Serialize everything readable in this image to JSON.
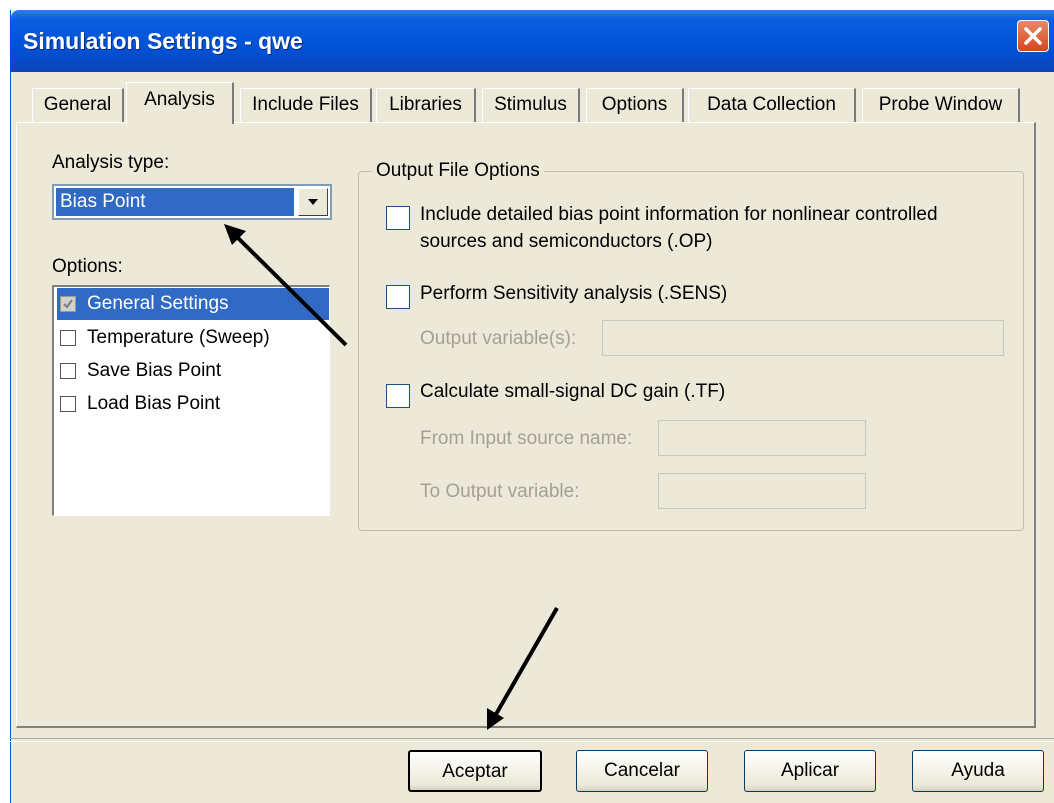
{
  "window": {
    "title": "Simulation Settings - qwe",
    "close_icon": "close-x-icon"
  },
  "tabs": [
    {
      "label": "General",
      "active": false
    },
    {
      "label": "Analysis",
      "active": true
    },
    {
      "label": "Include Files",
      "active": false
    },
    {
      "label": "Libraries",
      "active": false
    },
    {
      "label": "Stimulus",
      "active": false
    },
    {
      "label": "Options",
      "active": false
    },
    {
      "label": "Data Collection",
      "active": false
    },
    {
      "label": "Probe Window",
      "active": false
    }
  ],
  "analysis": {
    "type_label": "Analysis type:",
    "type_value": "Bias Point",
    "options_label": "Options:",
    "options": [
      {
        "label": "General Settings",
        "checked": true,
        "selected": true
      },
      {
        "label": "Temperature (Sweep)",
        "checked": false,
        "selected": false
      },
      {
        "label": "Save Bias Point",
        "checked": false,
        "selected": false
      },
      {
        "label": "Load Bias Point",
        "checked": false,
        "selected": false
      }
    ]
  },
  "output": {
    "group_title": "Output File Options",
    "op_line1": "Include detailed bias point information for nonlinear controlled",
    "op_line2": "sources and semiconductors (.OP)",
    "sens_label": "Perform Sensitivity analysis (.SENS)",
    "sens_output_label": "Output variable(s):",
    "sens_output_value": "",
    "tf_label": "Calculate small-signal DC gain (.TF)",
    "tf_from_label": "From Input source name:",
    "tf_from_value": "",
    "tf_to_label": "To Output variable:",
    "tf_to_value": ""
  },
  "buttons": {
    "ok": "Aceptar",
    "cancel": "Cancelar",
    "apply": "Aplicar",
    "help": "Ayuda"
  },
  "colors": {
    "titlebar": "#0052d6",
    "selection": "#316ac5",
    "dialog_bg": "#ece9d8",
    "close_button": "#d6451e"
  }
}
